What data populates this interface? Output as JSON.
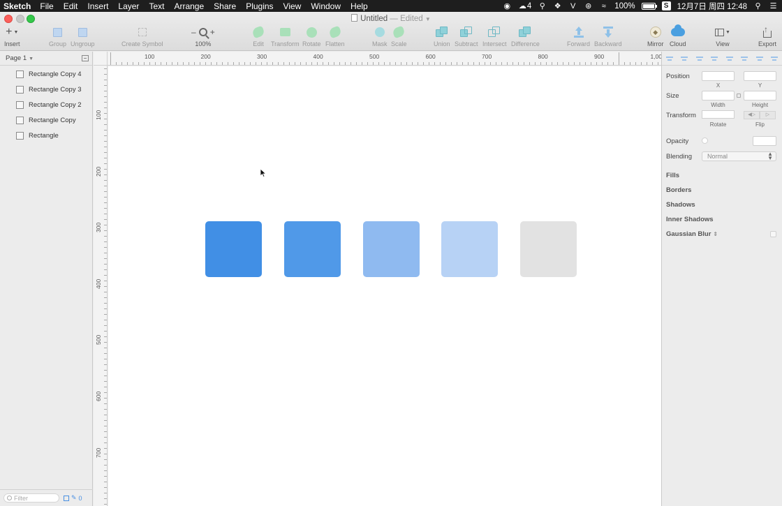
{
  "menubar": {
    "app": "Sketch",
    "items": [
      "File",
      "Edit",
      "Insert",
      "Layer",
      "Text",
      "Arrange",
      "Share",
      "Plugins",
      "View",
      "Window",
      "Help"
    ],
    "wechat_count": "4",
    "battery": "100%",
    "datetime": "12月7日 周四 12:48"
  },
  "window": {
    "title": "Untitled",
    "edited": "— Edited"
  },
  "toolbar": {
    "insert": "Insert",
    "group": "Group",
    "ungroup": "Ungroup",
    "create_symbol": "Create Symbol",
    "zoom": "100%",
    "edit": "Edit",
    "transform": "Transform",
    "rotate": "Rotate",
    "flatten": "Flatten",
    "mask": "Mask",
    "scale": "Scale",
    "union": "Union",
    "subtract": "Subtract",
    "intersect": "Intersect",
    "difference": "Difference",
    "forward": "Forward",
    "backward": "Backward",
    "mirror": "Mirror",
    "cloud": "Cloud",
    "view": "View",
    "export": "Export"
  },
  "layers": {
    "page": "Page 1",
    "items": [
      "Rectangle Copy 4",
      "Rectangle Copy 3",
      "Rectangle Copy 2",
      "Rectangle Copy",
      "Rectangle"
    ],
    "filter_placeholder": "Filter",
    "slice_count": "0"
  },
  "rulers": {
    "top_labels": [
      "100",
      "200",
      "300",
      "400",
      "500",
      "600",
      "700",
      "800",
      "900",
      "1,00"
    ],
    "left_labels": [
      "100",
      "200",
      "300",
      "400",
      "500",
      "600",
      "700"
    ]
  },
  "canvas": {
    "rectangles": [
      {
        "name": "Rectangle",
        "color": "#418fe5"
      },
      {
        "name": "Rectangle Copy",
        "color": "#5099e8"
      },
      {
        "name": "Rectangle Copy 2",
        "color": "#8fbaf0"
      },
      {
        "name": "Rectangle Copy 3",
        "color": "#b7d2f5"
      },
      {
        "name": "Rectangle Copy 4",
        "color": "#e2e2e2"
      }
    ]
  },
  "inspector": {
    "position": "Position",
    "x": "X",
    "y": "Y",
    "size": "Size",
    "width": "Width",
    "height": "Height",
    "transform": "Transform",
    "rotate": "Rotate",
    "flip": "Flip",
    "opacity": "Opacity",
    "blending": "Blending",
    "blending_value": "Normal",
    "fills": "Fills",
    "borders": "Borders",
    "shadows": "Shadows",
    "inner_shadows": "Inner Shadows",
    "gaussian_blur": "Gaussian Blur"
  }
}
